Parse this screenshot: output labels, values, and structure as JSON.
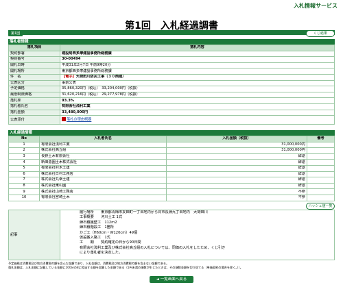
{
  "header": {
    "service": "入札情報サービス",
    "title": "第1回　入札経過調書"
  },
  "tag": "第1回",
  "list_button": "くじ結果",
  "haishin_button": "ハッシュ値一覧",
  "section1": {
    "title": "落札者情報",
    "col_item": "落札項目",
    "col_content": "落札内容",
    "rows": [
      {
        "label": "契約部署",
        "value": "建設局西多摩建設事務所総務課",
        "bold": true
      },
      {
        "label": "契約番号",
        "value": "30-00494",
        "bold": true
      },
      {
        "label": "開札日時",
        "value": "平成31年2月7日 午前9時20分",
        "bold": false
      },
      {
        "label": "開札場所",
        "value": "東京都西多摩建設事務所総務課",
        "bold": false
      },
      {
        "label": "件　名",
        "value_prefix": "【電子】",
        "value": "大荷田川防災工事（３０西建）",
        "bold": true
      },
      {
        "label": "公表区分",
        "value": "事前公表",
        "bold": false
      },
      {
        "label": "予定価格",
        "value": "35,860,320円（税込）　33,204,000円（税抜）",
        "bold": false
      },
      {
        "label": "最低制限価格",
        "value": "31,620,216円（税込）　29,277,978円（税抜）",
        "bold": false
      },
      {
        "label": "落札率",
        "value": "93.3%",
        "bold": true
      },
      {
        "label": "落札者氏名",
        "value": "有限会社浅利工業",
        "bold": true
      },
      {
        "label": "落札金額",
        "value": "33,480,000円",
        "bold": true
      },
      {
        "label": "公表添付",
        "value": "落札の理由概要",
        "bold": false
      }
    ]
  },
  "section2": {
    "title": "入札経過情報",
    "columns": [
      "No",
      "入札者氏名",
      "入札金額（税抜）",
      "備考"
    ],
    "rows": [
      {
        "no": "1",
        "name": "有限会社浅利工業",
        "amount": "31,000,000円",
        "note": ""
      },
      {
        "no": "2",
        "name": "株式会社高丘組",
        "amount": "31,000,000円",
        "note": ""
      },
      {
        "no": "3",
        "name": "長野土木有限会社",
        "amount": "辞退",
        "note": ""
      },
      {
        "no": "4",
        "name": "新田造園土木株式会社",
        "amount": "辞退",
        "note": ""
      },
      {
        "no": "5",
        "name": "有限会社村木土建",
        "amount": "辞退",
        "note": ""
      },
      {
        "no": "6",
        "name": "株式会社日村工務店",
        "amount": "辞退",
        "note": ""
      },
      {
        "no": "7",
        "name": "株式会社丸幸土建",
        "amount": "辞退",
        "note": ""
      },
      {
        "no": "8",
        "name": "株式会社東山園",
        "amount": "辞退",
        "note": ""
      },
      {
        "no": "9",
        "name": "株式会社山崎工務店",
        "amount": "不参",
        "note": ""
      },
      {
        "no": "10",
        "name": "有限会社宮崎土木",
        "amount": "不参",
        "note": ""
      }
    ]
  },
  "remarks": {
    "label": "記事",
    "lines": [
      "履行場所　　東京都青梅市友田町一丁目地内から同市長淵九丁目地内　大荷田川",
      "工事概要　　河川土工 1式",
      "練石積擁壁工　112m2",
      "練石積階段工　1箇所",
      "かご工（H60cm・W120cm）49個",
      "仮設搬入路工　1式",
      "工　　期　　契約確定の日から90日間",
      "有限会社浅利工業及び株式会社高丘組の入札については、同価の入札をしたため、くじ引き",
      "により落札者を決定した。"
    ]
  },
  "notes": [
    "予定価格は消費税及び地方消費税の額を含んだ金額であり、入札金額は、消費税及び地方消費税の額を含まない金額である。",
    "落札金額は、入札金額に記載している金額に100分の8に相当する額を加算した金額である（1円未満の端数が生じたときは、その端数金額を切り捨てる（単価契約の場合を除く。））。"
  ],
  "back_button": "一覧画面へ戻る"
}
